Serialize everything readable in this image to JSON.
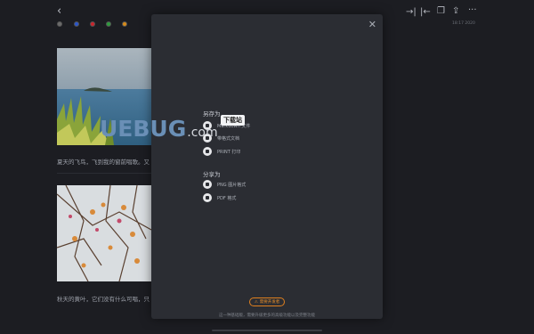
{
  "topbar": {
    "back_icon": "chevron-left-icon",
    "right_icons": [
      "indent-right-icon",
      "indent-left-icon",
      "copy-icon",
      "export-icon",
      "more-icon"
    ],
    "timestamp": "18:17 2020"
  },
  "colors": {
    "background": "#1c1d22",
    "modal": "#2b2d33",
    "accent": "#e0801f",
    "dots": [
      "#6b6b6b",
      "#2c56c9",
      "#c9252d",
      "#2f9b3e",
      "#d68a1a"
    ]
  },
  "editor": {
    "caption_1": "夏天的飞鸟，飞到我的窗前唱歌。又",
    "caption_2": "秋天的黄叶，它们没有什么可唱，只"
  },
  "modal": {
    "save_as_title": "另存为",
    "save_as_items": [
      {
        "label": "Markdown 文件",
        "icon": "markdown-icon"
      },
      {
        "label": "带格式文档",
        "icon": "document-icon"
      },
      {
        "label": "PRINT 打印",
        "icon": "print-icon"
      }
    ],
    "share_title": "分享为",
    "share_items": [
      {
        "label": "PNG 图片格式",
        "icon": "image-icon"
      },
      {
        "label": "PDF 格式",
        "icon": "pdf-icon"
      }
    ],
    "upgrade_label": "需要开发者",
    "footer_note": "这一种基础版，需要升级更多的高级功能以及完整功能"
  },
  "watermark": {
    "text": "UEBUG",
    "suffix": ".com",
    "tag": "下载站"
  }
}
